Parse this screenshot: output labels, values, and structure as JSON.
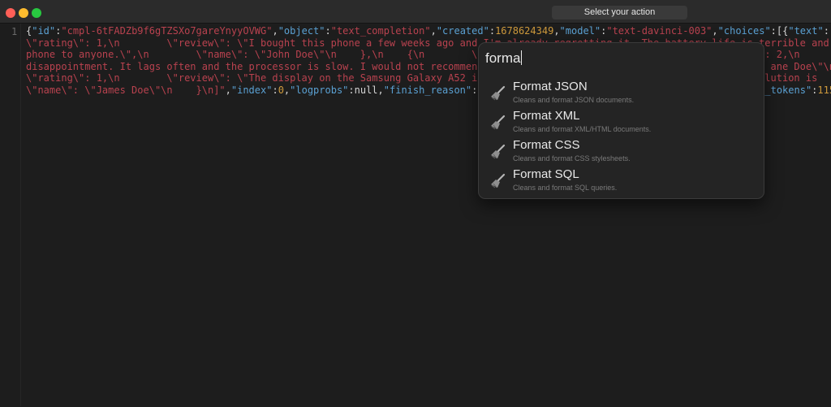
{
  "window": {
    "action_label": "Select your action"
  },
  "editor": {
    "line_number": "1",
    "lines": [
      [
        {
          "t": "{",
          "c": "punc"
        },
        {
          "t": "\"id\"",
          "c": "key"
        },
        {
          "t": ":",
          "c": "punc"
        },
        {
          "t": "\"cmpl-6tFADZb9f6gTZSXo7gareYnyyOVWG\"",
          "c": "str"
        },
        {
          "t": ",",
          "c": "punc"
        },
        {
          "t": "\"object\"",
          "c": "key"
        },
        {
          "t": ":",
          "c": "punc"
        },
        {
          "t": "\"text_completion\"",
          "c": "str"
        },
        {
          "t": ",",
          "c": "punc"
        },
        {
          "t": "\"created\"",
          "c": "key"
        },
        {
          "t": ":",
          "c": "punc"
        },
        {
          "t": "1678624349",
          "c": "num"
        },
        {
          "t": ",",
          "c": "punc"
        },
        {
          "t": "\"model\"",
          "c": "key"
        },
        {
          "t": ":",
          "c": "punc"
        },
        {
          "t": "\"text-davinci-003\"",
          "c": "str"
        },
        {
          "t": ",",
          "c": "punc"
        },
        {
          "t": "\"choices\"",
          "c": "key"
        },
        {
          "t": ":[{",
          "c": "punc"
        },
        {
          "t": "\"text\"",
          "c": "key"
        },
        {
          "t": ":",
          "c": "punc"
        }
      ],
      [
        {
          "t": "\\\"rating\\\": 1,\\n        \\\"review\\\": \\\"I bought this phone a few weeks ago and I'm already regretting it. The battery life is terrible and",
          "c": "str"
        }
      ],
      [
        {
          "t": "phone to anyone.\\\",\\n        \\\"name\\\": \\\"John Doe\\\"\\n    },\\n    {\\n        \\\"",
          "c": "str"
        },
        {
          "t": "                                              \\\": 2,\\n",
          "c": "str"
        }
      ],
      [
        {
          "t": "disappointment. It lags often and the processor is slow. I would not recommen",
          "c": "str"
        },
        {
          "t": "                                                  ane Doe\\\"\\n",
          "c": "str"
        }
      ],
      [
        {
          "t": "\\\"rating\\\": 1,\\n        \\\"review\\\": \\\"The display on the Samsung Galaxy A52 i",
          "c": "str"
        },
        {
          "t": "                                                olution is",
          "c": "str"
        }
      ],
      [
        {
          "t": "\\\"name\\\": \\\"James Doe\\\"\\n    }\\n]\"",
          "c": "str"
        },
        {
          "t": ",",
          "c": "punc"
        },
        {
          "t": "\"index\"",
          "c": "key"
        },
        {
          "t": ":",
          "c": "punc"
        },
        {
          "t": "0",
          "c": "num"
        },
        {
          "t": ",",
          "c": "punc"
        },
        {
          "t": "\"logprobs\"",
          "c": "key"
        },
        {
          "t": ":null,",
          "c": "punc"
        },
        {
          "t": "\"finish_reason\"",
          "c": "key"
        },
        {
          "t": ":                                                 ",
          "c": "punc"
        },
        {
          "t": "_tokens\"",
          "c": "key"
        },
        {
          "t": ":",
          "c": "punc"
        },
        {
          "t": "115",
          "c": "num"
        }
      ]
    ]
  },
  "palette": {
    "query": "forma",
    "items": [
      {
        "title": "Format JSON",
        "desc": "Cleans and format JSON documents."
      },
      {
        "title": "Format XML",
        "desc": "Cleans and format XML/HTML documents."
      },
      {
        "title": "Format CSS",
        "desc": "Cleans and format CSS stylesheets."
      },
      {
        "title": "Format SQL",
        "desc": "Cleans and format SQL queries."
      }
    ]
  },
  "colors": {
    "string": "#b9424f",
    "key": "#5aa0d2",
    "number": "#cf9a3c",
    "punctuation": "#d4d4d4"
  },
  "icons": {
    "item_icon": "broom-icon"
  }
}
